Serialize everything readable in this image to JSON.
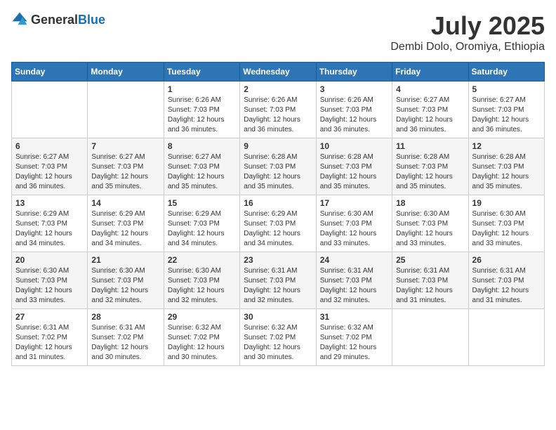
{
  "header": {
    "logo_general": "General",
    "logo_blue": "Blue",
    "month": "July 2025",
    "location": "Dembi Dolo, Oromiya, Ethiopia"
  },
  "weekdays": [
    "Sunday",
    "Monday",
    "Tuesday",
    "Wednesday",
    "Thursday",
    "Friday",
    "Saturday"
  ],
  "weeks": [
    [
      {
        "day": "",
        "info": ""
      },
      {
        "day": "",
        "info": ""
      },
      {
        "day": "1",
        "info": "Sunrise: 6:26 AM\nSunset: 7:03 PM\nDaylight: 12 hours and 36 minutes."
      },
      {
        "day": "2",
        "info": "Sunrise: 6:26 AM\nSunset: 7:03 PM\nDaylight: 12 hours and 36 minutes."
      },
      {
        "day": "3",
        "info": "Sunrise: 6:26 AM\nSunset: 7:03 PM\nDaylight: 12 hours and 36 minutes."
      },
      {
        "day": "4",
        "info": "Sunrise: 6:27 AM\nSunset: 7:03 PM\nDaylight: 12 hours and 36 minutes."
      },
      {
        "day": "5",
        "info": "Sunrise: 6:27 AM\nSunset: 7:03 PM\nDaylight: 12 hours and 36 minutes."
      }
    ],
    [
      {
        "day": "6",
        "info": "Sunrise: 6:27 AM\nSunset: 7:03 PM\nDaylight: 12 hours and 36 minutes."
      },
      {
        "day": "7",
        "info": "Sunrise: 6:27 AM\nSunset: 7:03 PM\nDaylight: 12 hours and 35 minutes."
      },
      {
        "day": "8",
        "info": "Sunrise: 6:27 AM\nSunset: 7:03 PM\nDaylight: 12 hours and 35 minutes."
      },
      {
        "day": "9",
        "info": "Sunrise: 6:28 AM\nSunset: 7:03 PM\nDaylight: 12 hours and 35 minutes."
      },
      {
        "day": "10",
        "info": "Sunrise: 6:28 AM\nSunset: 7:03 PM\nDaylight: 12 hours and 35 minutes."
      },
      {
        "day": "11",
        "info": "Sunrise: 6:28 AM\nSunset: 7:03 PM\nDaylight: 12 hours and 35 minutes."
      },
      {
        "day": "12",
        "info": "Sunrise: 6:28 AM\nSunset: 7:03 PM\nDaylight: 12 hours and 35 minutes."
      }
    ],
    [
      {
        "day": "13",
        "info": "Sunrise: 6:29 AM\nSunset: 7:03 PM\nDaylight: 12 hours and 34 minutes."
      },
      {
        "day": "14",
        "info": "Sunrise: 6:29 AM\nSunset: 7:03 PM\nDaylight: 12 hours and 34 minutes."
      },
      {
        "day": "15",
        "info": "Sunrise: 6:29 AM\nSunset: 7:03 PM\nDaylight: 12 hours and 34 minutes."
      },
      {
        "day": "16",
        "info": "Sunrise: 6:29 AM\nSunset: 7:03 PM\nDaylight: 12 hours and 34 minutes."
      },
      {
        "day": "17",
        "info": "Sunrise: 6:30 AM\nSunset: 7:03 PM\nDaylight: 12 hours and 33 minutes."
      },
      {
        "day": "18",
        "info": "Sunrise: 6:30 AM\nSunset: 7:03 PM\nDaylight: 12 hours and 33 minutes."
      },
      {
        "day": "19",
        "info": "Sunrise: 6:30 AM\nSunset: 7:03 PM\nDaylight: 12 hours and 33 minutes."
      }
    ],
    [
      {
        "day": "20",
        "info": "Sunrise: 6:30 AM\nSunset: 7:03 PM\nDaylight: 12 hours and 33 minutes."
      },
      {
        "day": "21",
        "info": "Sunrise: 6:30 AM\nSunset: 7:03 PM\nDaylight: 12 hours and 32 minutes."
      },
      {
        "day": "22",
        "info": "Sunrise: 6:30 AM\nSunset: 7:03 PM\nDaylight: 12 hours and 32 minutes."
      },
      {
        "day": "23",
        "info": "Sunrise: 6:31 AM\nSunset: 7:03 PM\nDaylight: 12 hours and 32 minutes."
      },
      {
        "day": "24",
        "info": "Sunrise: 6:31 AM\nSunset: 7:03 PM\nDaylight: 12 hours and 32 minutes."
      },
      {
        "day": "25",
        "info": "Sunrise: 6:31 AM\nSunset: 7:03 PM\nDaylight: 12 hours and 31 minutes."
      },
      {
        "day": "26",
        "info": "Sunrise: 6:31 AM\nSunset: 7:03 PM\nDaylight: 12 hours and 31 minutes."
      }
    ],
    [
      {
        "day": "27",
        "info": "Sunrise: 6:31 AM\nSunset: 7:02 PM\nDaylight: 12 hours and 31 minutes."
      },
      {
        "day": "28",
        "info": "Sunrise: 6:31 AM\nSunset: 7:02 PM\nDaylight: 12 hours and 30 minutes."
      },
      {
        "day": "29",
        "info": "Sunrise: 6:32 AM\nSunset: 7:02 PM\nDaylight: 12 hours and 30 minutes."
      },
      {
        "day": "30",
        "info": "Sunrise: 6:32 AM\nSunset: 7:02 PM\nDaylight: 12 hours and 30 minutes."
      },
      {
        "day": "31",
        "info": "Sunrise: 6:32 AM\nSunset: 7:02 PM\nDaylight: 12 hours and 29 minutes."
      },
      {
        "day": "",
        "info": ""
      },
      {
        "day": "",
        "info": ""
      }
    ]
  ]
}
